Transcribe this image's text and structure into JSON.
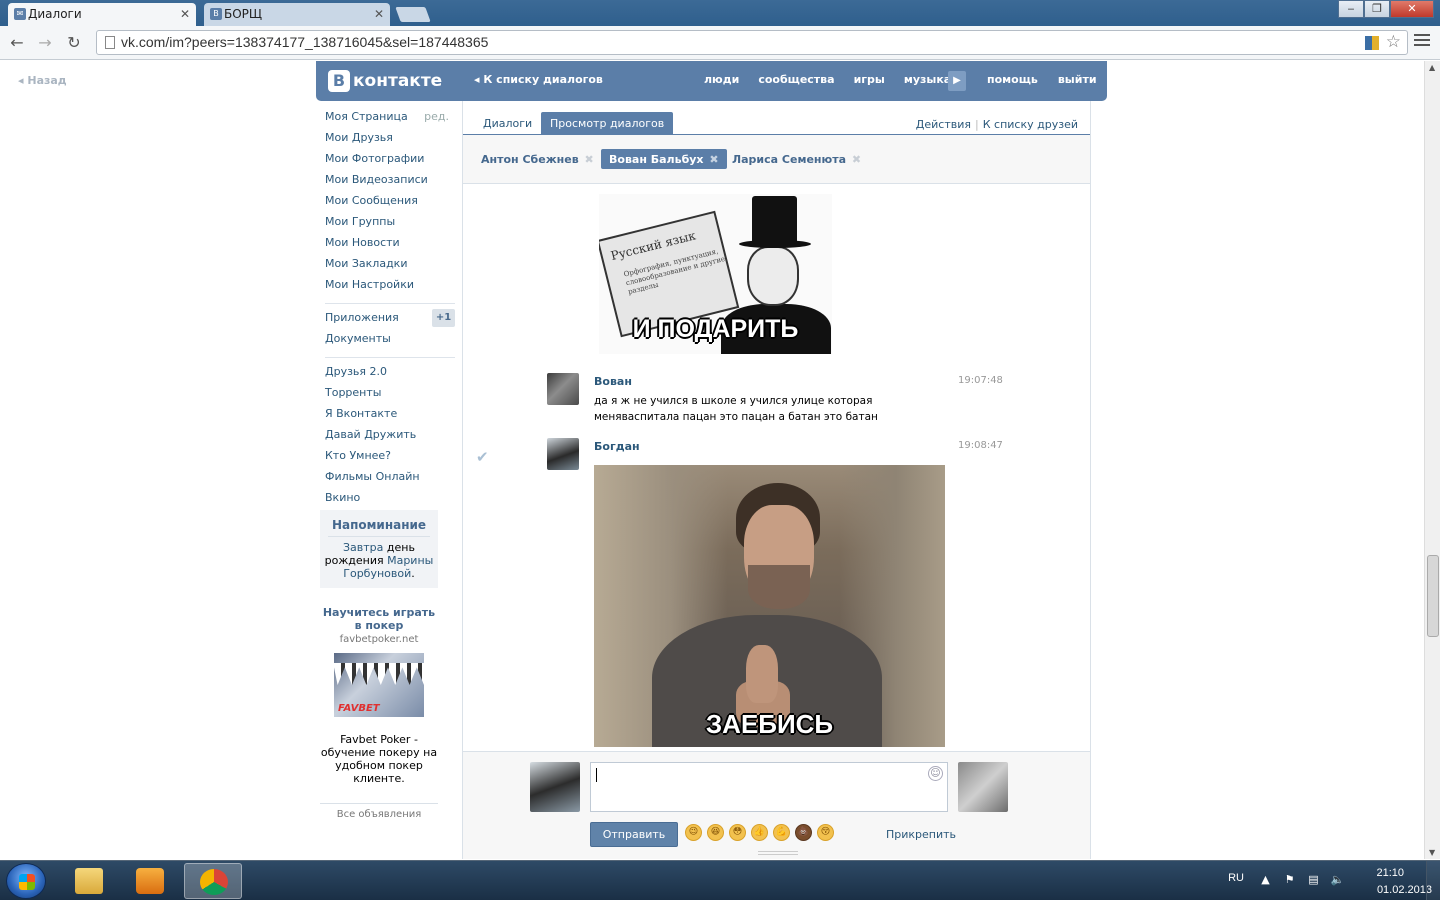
{
  "browser": {
    "tabs": [
      {
        "title": "Диалоги",
        "active": true
      },
      {
        "title": "БОРЩ",
        "active": false
      }
    ],
    "url": "vk.com/im?peers=138374177_138716045&sel=187448365",
    "window_buttons": [
      "‒",
      "❐",
      "✕"
    ]
  },
  "page": {
    "back_link": "Назад",
    "header": {
      "logo_letter": "В",
      "logo_text": "контакте",
      "back_to_dialogs": "К списку диалогов",
      "nav": [
        "люди",
        "сообщества",
        "игры",
        "музыка"
      ],
      "nav_right": [
        "помощь",
        "выйти"
      ]
    },
    "left_menu": {
      "edit_label": "ред.",
      "group1": [
        "Моя Страница",
        "Мои Друзья",
        "Мои Фотографии",
        "Мои Видеозаписи",
        "Мои Сообщения",
        "Мои Группы",
        "Мои Новости",
        "Мои Закладки",
        "Мои Настройки"
      ],
      "group2": [
        "Приложения",
        "Документы"
      ],
      "apps_badge": "+1",
      "group3": [
        "Друзья 2.0",
        "Торренты",
        "Я Вконтакте",
        "Давай Дружить",
        "Кто Умнее?",
        "Фильмы Онлайн",
        "Вкино"
      ]
    },
    "reminder": {
      "title": "Напоминание",
      "word_tomorrow": "Завтра",
      "word_birthday_1": "день",
      "word_birthday_2": "рождения",
      "name_1": "Марины",
      "name_2": "Горбуновой"
    },
    "ad": {
      "title": "Научитесь играть в покер",
      "domain": "favbetpoker.net",
      "logo": "FAVBET",
      "description": "Favbet Poker - обучение покеру на удобном покер клиенте.",
      "all_ads": "Все объявления"
    },
    "dialogs": {
      "tab_dialogs": "Диалоги",
      "tab_view": "Просмотр диалогов",
      "actions": "Действия",
      "to_friends": "К списку друзей",
      "peers": [
        {
          "name": "Антон Сбежнев",
          "selected": false
        },
        {
          "name": "Вован Бальбух",
          "selected": true
        },
        {
          "name": "Лариса Семенюта",
          "selected": false
        }
      ],
      "meme1": {
        "book_title": "Русский язык",
        "book_subtitle": "Орфография, пунктуация, словообразование и другие разделы",
        "caption": "И ПОДАРИТЬ"
      },
      "messages": [
        {
          "author": "Вован",
          "time": "19:07:48",
          "text": "да я ж не учился в школе я учился улице которая меняваспитала пацан это пацан а батан это батан"
        },
        {
          "author": "Богдан",
          "time": "19:08:47",
          "text": ""
        }
      ],
      "meme2_caption": "ЗАЕБИСЬ",
      "compose": {
        "send": "Отправить",
        "attach": "Прикрепить",
        "emojis": [
          "😉",
          "😆",
          "😳",
          "👍",
          "💪",
          "💩",
          "😚"
        ]
      }
    }
  },
  "taskbar": {
    "lang": "RU",
    "time": "21:10",
    "date": "01.02.2013"
  },
  "colors": {
    "vk_blue": "#5b7ea8",
    "link": "#2b587a"
  }
}
